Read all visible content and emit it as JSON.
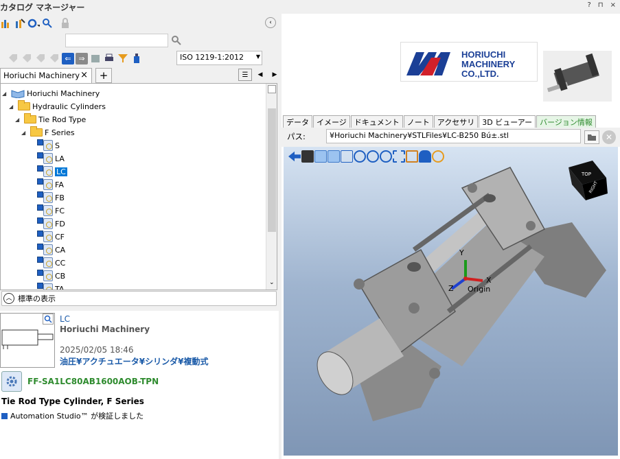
{
  "title": "カタログ マネージャー",
  "window_buttons": [
    "?",
    "⊓",
    "×"
  ],
  "iso_select": "ISO 1219-1:2012",
  "tabs": {
    "active": "Horiuchi Machinery",
    "plus": "+"
  },
  "tree": [
    {
      "label": "Horiuchi Machinery",
      "level": 0
    },
    {
      "label": "Hydraulic Cylinders",
      "level": 1
    },
    {
      "label": "Tie Rod Type",
      "level": 2
    },
    {
      "label": "F Series",
      "level": 3
    },
    {
      "label": "S",
      "level": 4
    },
    {
      "label": "LA",
      "level": 4
    },
    {
      "label": "LC",
      "level": 4,
      "selected": true
    },
    {
      "label": "FA",
      "level": 4
    },
    {
      "label": "FB",
      "level": 4
    },
    {
      "label": "FC",
      "level": 4
    },
    {
      "label": "FD",
      "level": 4
    },
    {
      "label": "CF",
      "level": 4
    },
    {
      "label": "CA",
      "level": 4
    },
    {
      "label": "CC",
      "level": 4
    },
    {
      "label": "CB",
      "level": 4
    },
    {
      "label": "TA",
      "level": 4
    }
  ],
  "std_view": "標準の表示",
  "detail": {
    "name": "LC",
    "maker": "Horiuchi Machinery",
    "date": "2025/02/05 18:46",
    "category": "油圧¥アクチュエータ¥シリンダ¥複動式",
    "code": "FF-SA1LC80AB1600AOB-TPN",
    "description": "Tie Rod Type Cylinder, F Series",
    "verified": "Automation Studio™ が検証しました"
  },
  "logo": {
    "line1": "HORIUCHI",
    "line2": "MACHINERY",
    "line3": "CO.,LTD."
  },
  "right_tabs": [
    "データ",
    "イメージ",
    "ドキュメント",
    "ノート",
    "アクセサリ",
    "3D ビューアー",
    "バージョン情報"
  ],
  "path_label": "パス:",
  "path_value": "¥Horiuchi Machinery¥STLFiles¥LC-B250 Bú±.stl",
  "axes": {
    "x": "X",
    "y": "Y",
    "z": "Z",
    "origin": "Origin"
  },
  "cube": {
    "top": "TOP",
    "right": "RIGHT"
  }
}
